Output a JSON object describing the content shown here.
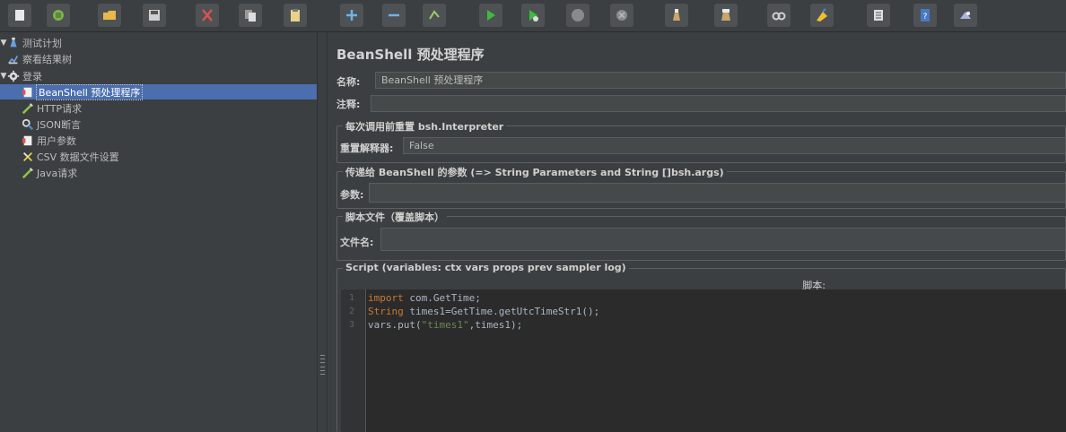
{
  "toolbar": {
    "buttons": [
      {
        "icon": "new-icon",
        "color": "#e8e8e8"
      },
      {
        "icon": "templates-icon",
        "color": "#7fb24a"
      },
      {
        "icon": "open-icon",
        "color": "#e8b84a"
      },
      {
        "icon": "save-icon",
        "color": "#cfcfcf"
      },
      {
        "icon": "cut-icon",
        "color": "#d9534f"
      },
      {
        "icon": "copy-icon",
        "color": "#dddddd"
      },
      {
        "icon": "paste-icon",
        "color": "#e8d28a"
      },
      {
        "icon": "expand-icon",
        "color": "#6fb3e8"
      },
      {
        "icon": "collapse-icon",
        "color": "#6fb3e8"
      },
      {
        "icon": "toggle-icon",
        "color": "#9acd6a"
      },
      {
        "icon": "start-icon",
        "color": "#3cbc3c"
      },
      {
        "icon": "start-no-pause-icon",
        "color": "#3cbc3c"
      },
      {
        "icon": "stop-icon",
        "color": "#8a8a8a"
      },
      {
        "icon": "shutdown-icon",
        "color": "#8a8a8a"
      },
      {
        "icon": "clear-icon",
        "color": "#c9a66b"
      },
      {
        "icon": "clear-all-icon",
        "color": "#c9a66b"
      },
      {
        "icon": "search-icon",
        "color": "#d0d0d0"
      },
      {
        "icon": "reset-search-icon",
        "color": "#f0c030"
      },
      {
        "icon": "function-helper-icon",
        "color": "#dddddd"
      },
      {
        "icon": "help-icon",
        "color": "#4a78c8"
      },
      {
        "icon": "remote-icon",
        "color": "#aab4e0"
      }
    ]
  },
  "tree": {
    "items": [
      {
        "label": "测试计划",
        "icon": "test-plan-icon",
        "toggle": "▼"
      },
      {
        "label": "察看结果树",
        "icon": "results-tree-icon",
        "toggle": ""
      },
      {
        "label": "登录",
        "icon": "thread-group-icon",
        "toggle": "▼"
      },
      {
        "label": "BeanShell 预处理程序",
        "icon": "preprocessor-icon",
        "toggle": ""
      },
      {
        "label": "HTTP请求",
        "icon": "sampler-icon",
        "toggle": ""
      },
      {
        "label": "JSON断言",
        "icon": "assertion-icon",
        "toggle": ""
      },
      {
        "label": "用户参数",
        "icon": "preprocessor-icon",
        "toggle": ""
      },
      {
        "label": "CSV 数据文件设置",
        "icon": "config-icon",
        "toggle": ""
      },
      {
        "label": "Java请求",
        "icon": "sampler-icon",
        "toggle": ""
      }
    ]
  },
  "main": {
    "title": "BeanShell 预处理程序",
    "name_label": "名称:",
    "name_value": "BeanShell 预处理程序",
    "comment_label": "注释:",
    "comment_value": "",
    "reset_group": {
      "title": "每次调用前重置 bsh.Interpreter",
      "label": "重置解释器:",
      "value": "False"
    },
    "params_group": {
      "title": "传递给 BeanShell 的参数 (=> String Parameters and String []bsh.args)",
      "label": "参数:",
      "value": ""
    },
    "file_group": {
      "title": "脚本文件（覆盖脚本）",
      "label": "文件名:",
      "value": ""
    },
    "script_group": {
      "title": "Script (variables: ctx vars props prev sampler log)",
      "header": "脚本:",
      "lines": [
        {
          "num": "1",
          "parts": [
            {
              "t": "import",
              "c": "kw"
            },
            {
              "t": " com.GetTime;",
              "c": ""
            }
          ]
        },
        {
          "num": "2",
          "parts": [
            {
              "t": "String",
              "c": "kw"
            },
            {
              "t": " times1=GetTime.getUtcTimeStr1();",
              "c": ""
            }
          ]
        },
        {
          "num": "3",
          "parts": [
            {
              "t": "vars.put(",
              "c": ""
            },
            {
              "t": "\"times1\"",
              "c": "str"
            },
            {
              "t": ",times1);",
              "c": ""
            }
          ]
        }
      ]
    }
  }
}
